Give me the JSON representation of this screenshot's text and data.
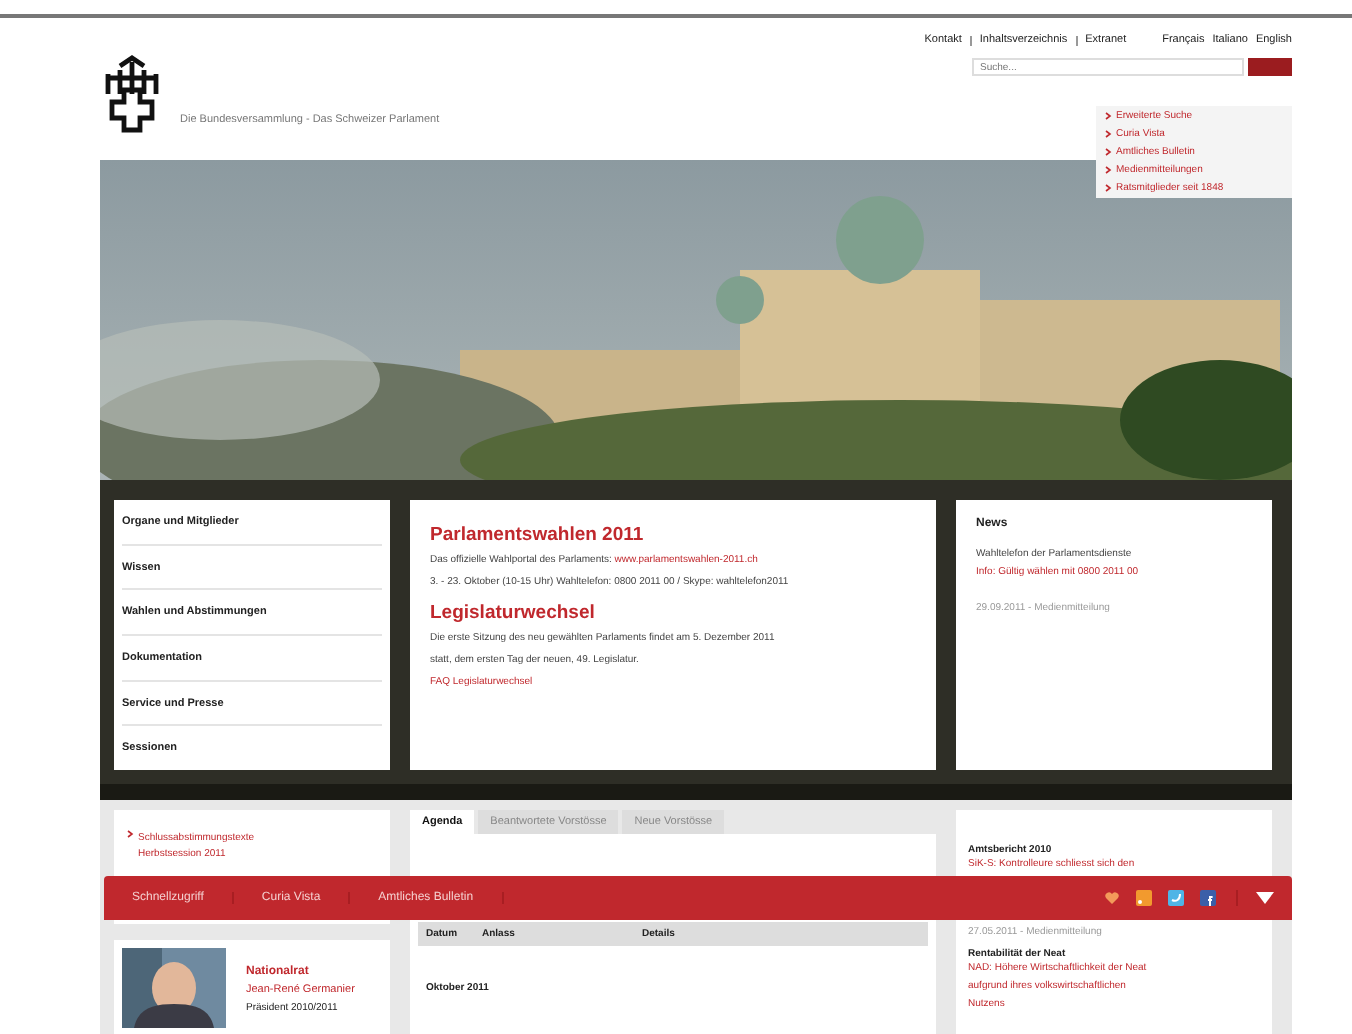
{
  "top_links": [
    "Kontakt",
    "Inhaltsverzeichnis",
    "Extranet"
  ],
  "languages": [
    "Français",
    "Italiano",
    "English"
  ],
  "search": {
    "placeholder": "Suche..."
  },
  "search_menu": [
    "Erweiterte Suche",
    "Curia Vista",
    "Amtliches Bulletin",
    "Medienmitteilungen",
    "Ratsmitglieder seit 1848"
  ],
  "tagline": "Die Bundesversammlung - Das Schweizer Parlament",
  "main_nav": [
    "Organe und Mitglieder",
    "Wissen",
    "Wahlen und Abstimmungen",
    "Dokumentation",
    "Service und Presse",
    "Sessionen"
  ],
  "feature": [
    {
      "title": "Parlamentswahlen 2011",
      "lines": [
        [
          {
            "kind": "text",
            "text": "Das offizielle Wahlportal des Parlaments: "
          },
          {
            "kind": "link",
            "text": "www.parlamentswahlen-2011.ch"
          }
        ],
        [
          {
            "kind": "text",
            "text": "3. - 23. Oktober (10-15 Uhr) Wahltelefon: 0800 2011 00 / Skype: wahltelefon2011"
          }
        ]
      ]
    },
    {
      "title": "Legislaturwechsel",
      "lines": [
        [
          {
            "kind": "text",
            "text": "Die erste Sitzung des neu gewählten Parlaments findet am 5. Dezember 2011"
          }
        ],
        [
          {
            "kind": "text",
            "text": "statt, dem ersten Tag der neuen, 49. Legislatur."
          }
        ],
        [
          {
            "kind": "link",
            "text": "FAQ Legislaturwechsel"
          }
        ]
      ]
    }
  ],
  "news": {
    "heading": "News",
    "title": "Wahltelefon der Parlamentsdienste",
    "link": "Info: Gültig wählen mit 0800 2011 00",
    "meta": "29.09.2011 - Medienmitteilung"
  },
  "sidebar_link": "Schlussabstimmungstexte Herbstsession 2011",
  "profile": {
    "council": "Nationalrat",
    "name": "Jean-René Germanier",
    "role": "Präsident 2010/2011"
  },
  "tabs": [
    {
      "label": "Agenda",
      "selected": true
    },
    {
      "label": "Beantwortete Vorstösse",
      "selected": false
    },
    {
      "label": "Neue Vorstösse",
      "selected": false
    }
  ],
  "agenda_table": {
    "columns": [
      "Datum",
      "Anlass",
      "Details"
    ],
    "month": "Oktober 2011"
  },
  "side_news": [
    {
      "title": "Amtsbericht 2010",
      "link": "SiK-S: Kontrolleure schliesst sich den"
    },
    {
      "meta": "27.05.2011 - Medienmitteilung",
      "title": "Rentabilität der Neat",
      "link": "NAD: Höhere Wirtschaftlichkeit der Neat aufgrund ihres volkswirtschaftlichen Nutzens"
    }
  ],
  "quick_bar": [
    "Schnellzugriff",
    "Curia Vista",
    "Amtliches Bulletin"
  ]
}
